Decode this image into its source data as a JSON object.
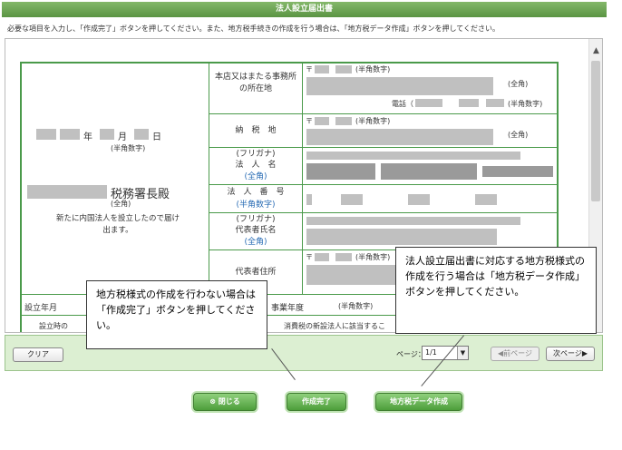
{
  "window": {
    "title": "法人設立届出書"
  },
  "instruction": "必要な項目を入力し、「作成完了」ボタンを押してください。また、地方税手続きの作成を行う場合は、「地方税データ作成」ボタンを押してください。",
  "form": {
    "date": {
      "year": "年",
      "month": "月",
      "day": "日",
      "hint": "(半角数字)"
    },
    "tax_office": {
      "suffix": "税務署長殿",
      "hint": "(全角)"
    },
    "declaration": "新たに内国法人を設立したので届け出ます。",
    "rows": {
      "hq": {
        "label": "本店又はまたる事務所の所在地",
        "zip_mark": "〒",
        "zip_hint": "(半角数字)",
        "addr_hint": "(全角)",
        "phone_label": "電話（",
        "phone_hint": "(半角数字)"
      },
      "tax_place": {
        "label": "納　税　地",
        "zip_mark": "〒",
        "zip_hint": "(半角数字)",
        "addr_hint": "(全角)"
      },
      "corp_name": {
        "furigana": "(フリガナ)",
        "label": "法　人　名",
        "hint": "(全角)"
      },
      "corp_number": {
        "label": "法　人　番　号",
        "hint": "(半角数字)"
      },
      "rep_name": {
        "furigana": "(フリガナ)",
        "label": "代表者氏名",
        "hint": "(全角)"
      },
      "rep_address": {
        "label": "代表者住所",
        "zip_mark": "〒",
        "zip_hint": "(半角数字)"
      },
      "est_date": {
        "label": "設立年月"
      },
      "fiscal": {
        "label": "事業年度",
        "hint": "(半角数字)"
      },
      "consumption": {
        "label": "設立時の",
        "text": "消費税の新設法人に該当するこ"
      }
    }
  },
  "toolbar": {
    "clear": "クリア",
    "page_label": "ページ：",
    "page_value": "1/1",
    "prev": "前ページ",
    "next": "次ページ"
  },
  "buttons": {
    "close": "閉じる",
    "complete": "作成完了",
    "local_tax": "地方税データ作成"
  },
  "callouts": {
    "left": "地方税様式の作成を行わない場合は「作成完了」ボタンを押してください。",
    "right": "法人設立届出書に対応する地方税様式の作成を行う場合は「地方税データ作成」ボタンを押してください。"
  },
  "colors": {
    "title_bar": "#5a9443",
    "form_border": "#4a9a4a",
    "toolbar": "#dcefd2",
    "hint": "#2a6db5"
  }
}
